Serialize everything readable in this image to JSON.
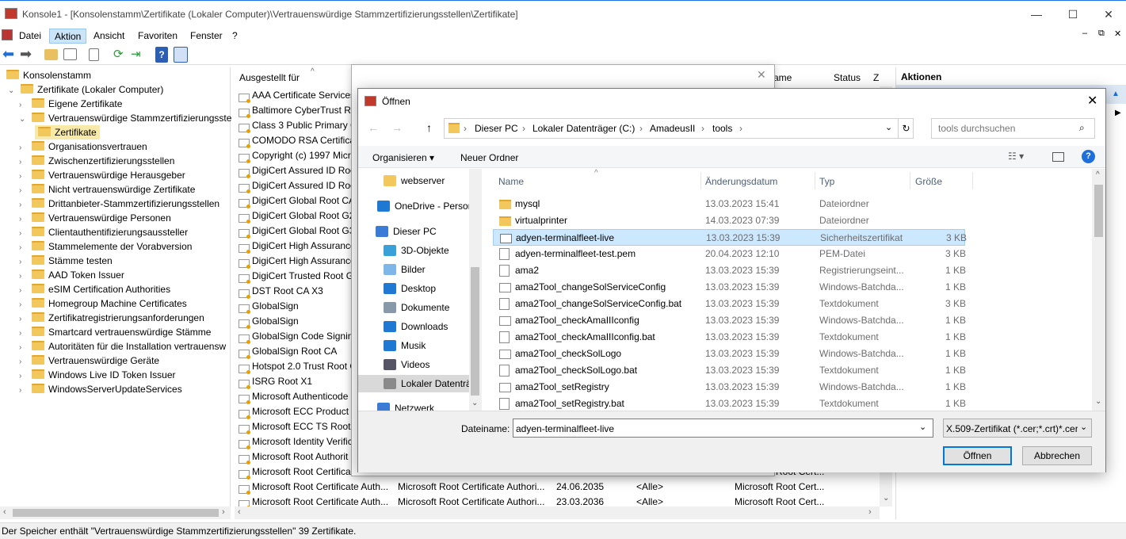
{
  "window": {
    "title": "Konsole1 - [Konsolenstamm\\Zertifikate (Lokaler Computer)\\Vertrauenswürdige Stammzertifizierungsstellen\\Zertifikate]"
  },
  "menu": [
    "Datei",
    "Aktion",
    "Ansicht",
    "Favoriten",
    "Fenster",
    "?"
  ],
  "tree": [
    {
      "label": "Konsolenstamm",
      "level": 0,
      "twist": ""
    },
    {
      "label": "Zertifikate (Lokaler Computer)",
      "level": 1,
      "twist": "⌄"
    },
    {
      "label": "Eigene Zertifikate",
      "level": 2,
      "twist": "›"
    },
    {
      "label": "Vertrauenswürdige Stammzertifizierungsste",
      "level": 2,
      "twist": "⌄"
    },
    {
      "label": "Zertifikate",
      "level": 3,
      "twist": ""
    },
    {
      "label": "Organisationsvertrauen",
      "level": 2,
      "twist": "›"
    },
    {
      "label": "Zwischenzertifizierungsstellen",
      "level": 2,
      "twist": "›"
    },
    {
      "label": "Vertrauenswürdige Herausgeber",
      "level": 2,
      "twist": "›"
    },
    {
      "label": "Nicht vertrauenswürdige Zertifikate",
      "level": 2,
      "twist": "›"
    },
    {
      "label": "Drittanbieter-Stammzertifizierungsstellen",
      "level": 2,
      "twist": "›"
    },
    {
      "label": "Vertrauenswürdige Personen",
      "level": 2,
      "twist": "›"
    },
    {
      "label": "Clientauthentifizierungsaussteller",
      "level": 2,
      "twist": "›"
    },
    {
      "label": "Stammelemente der Vorabversion",
      "level": 2,
      "twist": "›"
    },
    {
      "label": "Stämme testen",
      "level": 2,
      "twist": "›"
    },
    {
      "label": "AAD Token Issuer",
      "level": 2,
      "twist": "›"
    },
    {
      "label": "eSIM Certification Authorities",
      "level": 2,
      "twist": "›"
    },
    {
      "label": "Homegroup Machine Certificates",
      "level": 2,
      "twist": "›"
    },
    {
      "label": "Zertifikatregistrierungsanforderungen",
      "level": 2,
      "twist": "›"
    },
    {
      "label": "Smartcard vertrauenswürdige Stämme",
      "level": 2,
      "twist": "›"
    },
    {
      "label": "Autoritäten für die Installation vertrauensw",
      "level": 2,
      "twist": "›"
    },
    {
      "label": "Vertrauenswürdige Geräte",
      "level": 2,
      "twist": "›"
    },
    {
      "label": "Windows Live ID Token Issuer",
      "level": 2,
      "twist": "›"
    },
    {
      "label": "WindowsServerUpdateServices",
      "level": 2,
      "twist": "›"
    }
  ],
  "list": {
    "headers": {
      "issued_to": "Ausgestellt für",
      "name": "ame",
      "status": "Status",
      "z": "Z"
    },
    "rows": [
      [
        "AAA Certificate Services",
        "",
        "",
        "",
        ""
      ],
      [
        "Baltimore CyberTrust Ro",
        "",
        "",
        "",
        ""
      ],
      [
        "Class 3 Public Primary C",
        "",
        "",
        "",
        ""
      ],
      [
        "COMODO RSA Certificat",
        "",
        "",
        "",
        ""
      ],
      [
        "Copyright (c) 1997 Micr",
        "",
        "",
        "",
        ""
      ],
      [
        "DigiCert Assured ID Roo",
        "",
        "",
        "",
        ""
      ],
      [
        "DigiCert Assured ID Roo",
        "",
        "",
        "",
        ""
      ],
      [
        "DigiCert Global Root CA",
        "",
        "",
        "",
        ""
      ],
      [
        "DigiCert Global Root G2",
        "",
        "",
        "",
        ""
      ],
      [
        "DigiCert Global Root G3",
        "",
        "",
        "",
        ""
      ],
      [
        "DigiCert High Assurance",
        "",
        "",
        "",
        ""
      ],
      [
        "DigiCert High Assurance",
        "",
        "",
        "",
        ""
      ],
      [
        "DigiCert Trusted Root G4",
        "",
        "",
        "",
        ""
      ],
      [
        "DST Root CA X3",
        "",
        "",
        "",
        ""
      ],
      [
        "GlobalSign",
        "",
        "",
        "",
        ""
      ],
      [
        "GlobalSign",
        "",
        "",
        "",
        ""
      ],
      [
        "GlobalSign Code Signing",
        "",
        "",
        "",
        ""
      ],
      [
        "GlobalSign Root CA",
        "",
        "",
        "",
        ""
      ],
      [
        "Hotspot 2.0 Trust Root C",
        "",
        "",
        "",
        ""
      ],
      [
        "ISRG Root X1",
        "",
        "",
        "",
        ""
      ],
      [
        "Microsoft Authenticode",
        "",
        "",
        "",
        ""
      ],
      [
        "Microsoft ECC Product R",
        "",
        "",
        "",
        ""
      ],
      [
        "Microsoft ECC TS Root C",
        "",
        "",
        "",
        ""
      ],
      [
        "Microsoft Identity Verific",
        "",
        "",
        "",
        ""
      ],
      [
        "Microsoft Root Authorit",
        "",
        "",
        "",
        ""
      ],
      [
        "Microsoft Root Certifica",
        "",
        "",
        "",
        "Microsoft Root Cert..."
      ],
      [
        "Microsoft Root Certificate Auth...",
        "Microsoft Root Certificate Authori...",
        "24.06.2035",
        "<Alle>",
        "Microsoft Root Cert..."
      ],
      [
        "Microsoft Root Certificate Auth...",
        "Microsoft Root Certificate Authori...",
        "23.03.2036",
        "<Alle>",
        "Microsoft Root Cert..."
      ]
    ]
  },
  "actions": {
    "header": "Aktionen"
  },
  "status_text": "Der Speicher enthält \"Vertrauenswürdige Stammzertifizierungsstellen\" 39 Zertifikate.",
  "dialog": {
    "title": "Öffnen",
    "breadcrumb": [
      "Dieser PC",
      "Lokaler Datenträger (C:)",
      "AmadeusII",
      "tools"
    ],
    "search_placeholder": "tools durchsuchen",
    "organize": "Organisieren",
    "new_folder": "Neuer Ordner",
    "nav": [
      {
        "label": "webserver",
        "icon": "folder"
      },
      {
        "label": "OneDrive - Persor",
        "icon": "cloud"
      },
      {
        "label": "Dieser PC",
        "icon": "pc"
      },
      {
        "label": "3D-Objekte",
        "icon": "3d"
      },
      {
        "label": "Bilder",
        "icon": "pictures"
      },
      {
        "label": "Desktop",
        "icon": "desktop"
      },
      {
        "label": "Dokumente",
        "icon": "documents"
      },
      {
        "label": "Downloads",
        "icon": "downloads"
      },
      {
        "label": "Musik",
        "icon": "music"
      },
      {
        "label": "Videos",
        "icon": "videos"
      },
      {
        "label": "Lokaler Datenträ",
        "icon": "drive"
      },
      {
        "label": "Netzwerk",
        "icon": "network"
      }
    ],
    "columns": {
      "name": "Name",
      "date": "Änderungsdatum",
      "type": "Typ",
      "size": "Größe"
    },
    "files": [
      {
        "name": "mysql",
        "date": "13.03.2023 15:41",
        "type": "Dateiordner",
        "size": "",
        "kind": "folder"
      },
      {
        "name": "virtualprinter",
        "date": "14.03.2023 07:39",
        "type": "Dateiordner",
        "size": "",
        "kind": "folder"
      },
      {
        "name": "adyen-terminalfleet-live",
        "date": "13.03.2023 15:39",
        "type": "Sicherheitszertifikat",
        "size": "3 KB",
        "kind": "cert"
      },
      {
        "name": "adyen-terminalfleet-test.pem",
        "date": "20.04.2023 12:10",
        "type": "PEM-Datei",
        "size": "3 KB",
        "kind": "file"
      },
      {
        "name": "ama2",
        "date": "13.03.2023 15:39",
        "type": "Registrierungseint...",
        "size": "1 KB",
        "kind": "reg"
      },
      {
        "name": "ama2Tool_changeSolServiceConfig",
        "date": "13.03.2023 15:39",
        "type": "Windows-Batchda...",
        "size": "1 KB",
        "kind": "bat"
      },
      {
        "name": "ama2Tool_changeSolServiceConfig.bat",
        "date": "13.03.2023 15:39",
        "type": "Textdokument",
        "size": "3 KB",
        "kind": "txt"
      },
      {
        "name": "ama2Tool_checkAmaIIIconfig",
        "date": "13.03.2023 15:39",
        "type": "Windows-Batchda...",
        "size": "1 KB",
        "kind": "bat"
      },
      {
        "name": "ama2Tool_checkAmaIIIconfig.bat",
        "date": "13.03.2023 15:39",
        "type": "Textdokument",
        "size": "1 KB",
        "kind": "txt"
      },
      {
        "name": "ama2Tool_checkSolLogo",
        "date": "13.03.2023 15:39",
        "type": "Windows-Batchda...",
        "size": "1 KB",
        "kind": "bat"
      },
      {
        "name": "ama2Tool_checkSolLogo.bat",
        "date": "13.03.2023 15:39",
        "type": "Textdokument",
        "size": "1 KB",
        "kind": "txt"
      },
      {
        "name": "ama2Tool_setRegistry",
        "date": "13.03.2023 15:39",
        "type": "Windows-Batchda...",
        "size": "1 KB",
        "kind": "bat"
      },
      {
        "name": "ama2Tool_setRegistry.bat",
        "date": "13.03.2023 15:39",
        "type": "Textdokument",
        "size": "1 KB",
        "kind": "txt"
      }
    ],
    "filename_label": "Dateiname:",
    "filename_value": "adyen-terminalfleet-live",
    "filter": "X.509-Zertifikat (*.cer;*.crt)*.cer",
    "open": "Öffnen",
    "cancel": "Abbrechen",
    "selected_row": 2
  }
}
